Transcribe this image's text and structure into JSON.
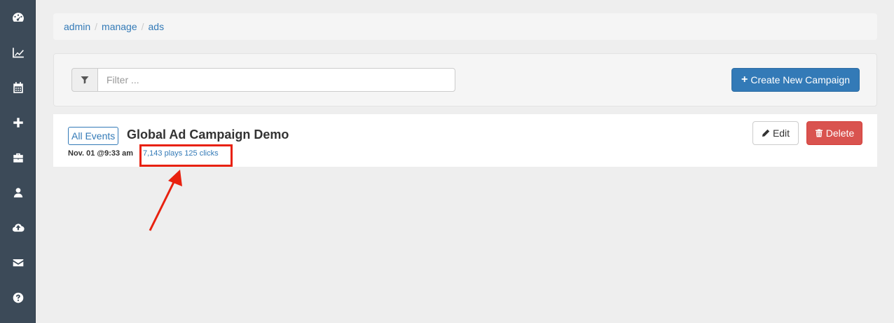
{
  "sidebar": {
    "items": [
      {
        "icon": "dashboard-icon"
      },
      {
        "icon": "line-chart-icon"
      },
      {
        "icon": "calendar-icon"
      },
      {
        "icon": "plus-icon"
      },
      {
        "icon": "briefcase-icon"
      },
      {
        "icon": "user-icon"
      },
      {
        "icon": "cloud-upload-icon"
      },
      {
        "icon": "envelope-icon"
      },
      {
        "icon": "question-circle-icon"
      }
    ]
  },
  "breadcrumb": {
    "items": [
      "admin",
      "manage",
      "ads"
    ],
    "separator": "/"
  },
  "toolbar": {
    "filter_placeholder": "Filter ...",
    "filter_icon": "filter-icon",
    "create_label": "Create New Campaign",
    "create_icon_glyph": "+"
  },
  "campaign": {
    "events_label": "All Events",
    "title": "Global Ad Campaign Demo",
    "date": "Nov. 01 @9:33 am",
    "stats": "7,143 plays 125 clicks",
    "edit_label": "Edit",
    "delete_label": "Delete"
  },
  "colors": {
    "sidebar_bg": "#3c4a58",
    "primary": "#337ab7",
    "danger": "#d9534f",
    "annotation": "#e8210f"
  }
}
